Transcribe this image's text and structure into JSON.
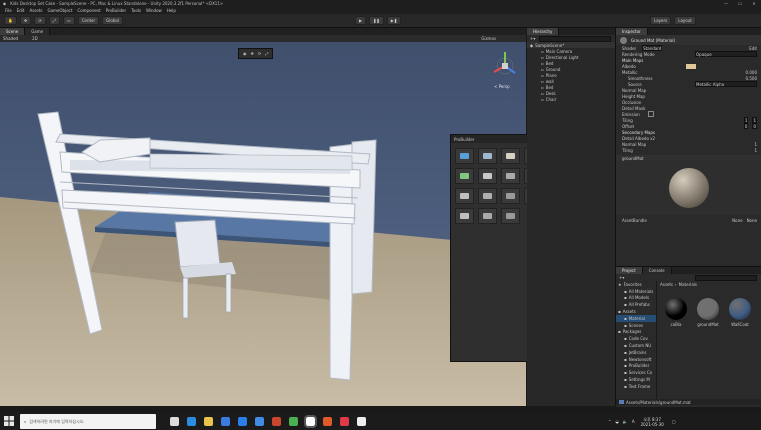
{
  "window": {
    "title": "Kids Desktop Set Cake - SampleScene - PC, Mac & Linux Standalone - Unity 2020.3.2f1 Personal* <DX11>",
    "controls": [
      "—",
      "☐",
      "✕"
    ]
  },
  "menu": [
    "File",
    "Edit",
    "Assets",
    "GameObject",
    "Component",
    "ProBuilder",
    "Tools",
    "Window",
    "Help"
  ],
  "toolbar": {
    "center_label": "Center",
    "global_label": "Global",
    "layers_label": "Layers",
    "layout_label": "Layout"
  },
  "scene": {
    "tabs": [
      "Scene",
      "Game"
    ],
    "shading": "Shaded",
    "mode_2d": "2D",
    "persp_label": "< Persp",
    "gizmos_label": "Gizmos"
  },
  "hierarchy": {
    "tab": "Hierarchy",
    "items": [
      "SampleScene*",
      "Main Camera",
      "Directional Light",
      "Bed",
      "Ground",
      "Plane",
      "wall",
      "Bed",
      "Desk",
      "Chair"
    ]
  },
  "palette": {
    "title": "ProBuilder",
    "icon_count": 18
  },
  "inspector": {
    "tab": "Inspector",
    "material": "Ground Mat (Material)",
    "shader": "Standard",
    "shader_label": "Shader",
    "edit_label": "Edit",
    "rendering_mode_label": "Rendering Mode",
    "rendering_mode": "Opaque",
    "main_maps": "Main Maps",
    "albedo": "Albedo",
    "metallic": "Metallic",
    "metallic_value": "0.000",
    "smoothness": "Smoothness",
    "smoothness_value": "0.500",
    "source": "Source",
    "source_value": "Metallic Alpha",
    "normal_map": "Normal Map",
    "height_map": "Height Map",
    "occlusion": "Occlusion",
    "detail_mask": "Detail Mask",
    "emission": "Emission",
    "tiling": "Tiling",
    "offset": "Offset",
    "tiling_x": "1",
    "tiling_y": "1",
    "offset_x": "0",
    "offset_y": "0",
    "secondary_maps": "Secondary Maps",
    "detail_albedo": "Detail Albedo x2",
    "secondary_normal": "Normal Map",
    "secondary_normal_value": "1",
    "tiling2": "Tiling",
    "tiling2_value": "1",
    "preview_label": "groundMat",
    "assetbundle_label": "AssetBundle",
    "assetbundle_value": "None",
    "assetbundle_value2": "None"
  },
  "project": {
    "tabs": [
      "Project",
      "Console"
    ],
    "tree": [
      "Favorites",
      "All Materials",
      "All Models",
      "All Prefabs",
      "Assets",
      "Material",
      "Scenes",
      "Packages",
      "Code Cov",
      "Custom NU",
      "JetBrains",
      "Newtonsoft",
      "ProBuilder",
      "Services Co",
      "Settings M",
      "Test Frame"
    ],
    "breadcrumb": [
      "Assets",
      "Materials"
    ],
    "materials": [
      {
        "name": "coBla",
        "color": "#000000"
      },
      {
        "name": "groundMat",
        "color": "#6f6f6f"
      },
      {
        "name": "WallCoat",
        "color": "#3f5c82"
      }
    ],
    "footer_path": "Assets/Materials/groundMat.mat"
  },
  "taskbar": {
    "search_placeholder": "검색하려면 여기에 입력하십시오.",
    "apps": [
      "task-view",
      "edge",
      "explorer",
      "store",
      "mail",
      "photos",
      "powerpoint",
      "chrome",
      "unity",
      "other",
      "music",
      "unity-hub"
    ],
    "time": "오후 8:37",
    "date": "2021-05-30"
  },
  "colors": {
    "sky": "#4a5a78",
    "ground": "#b3a58f",
    "desktop": "#5b7aa6",
    "accent": "#2f7ff0"
  }
}
